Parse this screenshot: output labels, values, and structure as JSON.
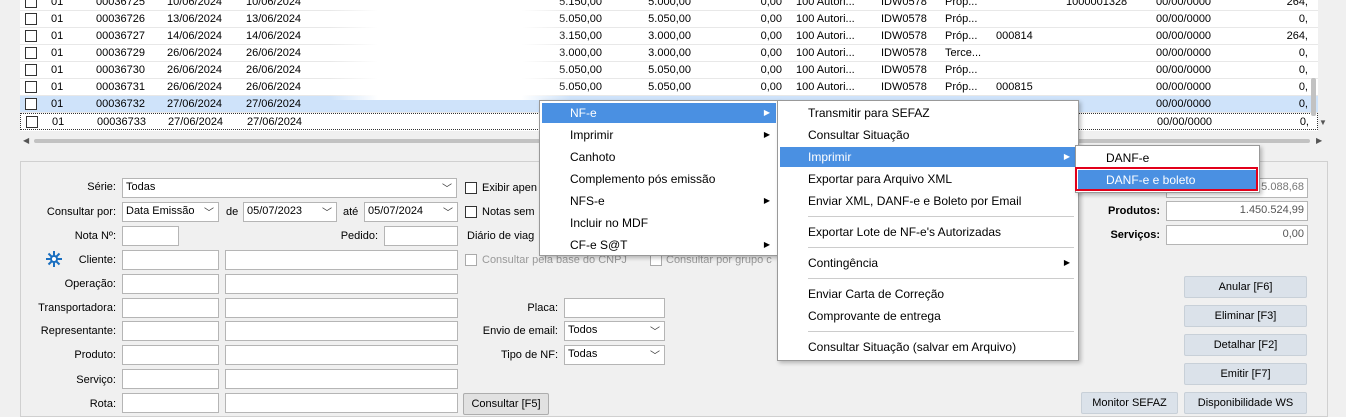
{
  "grid": {
    "rows": [
      {
        "serie": "01",
        "numero": "00036725",
        "emissao": "10/06/2024",
        "saida": "10/06/2024",
        "v1": "5.150,00",
        "v2": "5.000,00",
        "v3": "0,00",
        "status": "100 Autori...",
        "user": "IDW0578",
        "tipo": "Próp...",
        "mdf": "",
        "extra": "1000001328",
        "data": "00/00/0000",
        "last": "264,"
      },
      {
        "serie": "01",
        "numero": "00036726",
        "emissao": "13/06/2024",
        "saida": "13/06/2024",
        "v1": "5.050,00",
        "v2": "5.050,00",
        "v3": "0,00",
        "status": "100 Autori...",
        "user": "IDW0578",
        "tipo": "Próp...",
        "mdf": "",
        "extra": "",
        "data": "00/00/0000",
        "last": "0,"
      },
      {
        "serie": "01",
        "numero": "00036727",
        "emissao": "14/06/2024",
        "saida": "14/06/2024",
        "v1": "3.150,00",
        "v2": "3.000,00",
        "v3": "0,00",
        "status": "100 Autori...",
        "user": "IDW0578",
        "tipo": "Próp...",
        "mdf": "000814",
        "extra": "",
        "data": "00/00/0000",
        "last": "264,"
      },
      {
        "serie": "01",
        "numero": "00036729",
        "emissao": "26/06/2024",
        "saida": "26/06/2024",
        "v1": "3.000,00",
        "v2": "3.000,00",
        "v3": "0,00",
        "status": "100 Autori...",
        "user": "IDW0578",
        "tipo": "Terce...",
        "mdf": "",
        "extra": "",
        "data": "00/00/0000",
        "last": "0,"
      },
      {
        "serie": "01",
        "numero": "00036730",
        "emissao": "26/06/2024",
        "saida": "26/06/2024",
        "v1": "5.050,00",
        "v2": "5.050,00",
        "v3": "0,00",
        "status": "100 Autori...",
        "user": "IDW0578",
        "tipo": "Próp...",
        "mdf": "",
        "extra": "",
        "data": "00/00/0000",
        "last": "0,"
      },
      {
        "serie": "01",
        "numero": "00036731",
        "emissao": "26/06/2024",
        "saida": "26/06/2024",
        "v1": "5.050,00",
        "v2": "5.050,00",
        "v3": "0,00",
        "status": "100 Autori...",
        "user": "IDW0578",
        "tipo": "Próp...",
        "mdf": "000815",
        "extra": "",
        "data": "00/00/0000",
        "last": "0,"
      },
      {
        "serie": "01",
        "numero": "00036732",
        "emissao": "27/06/2024",
        "saida": "27/06/2024",
        "v1": "",
        "v2": "",
        "v3": "",
        "status": "",
        "user": "",
        "tipo": "",
        "mdf": "",
        "extra": "",
        "data": "00/00/0000",
        "last": "0,"
      },
      {
        "serie": "01",
        "numero": "00036733",
        "emissao": "27/06/2024",
        "saida": "27/06/2024",
        "v1": "",
        "v2": "",
        "v3": "",
        "status": "",
        "user": "",
        "tipo": "",
        "mdf": "",
        "extra": "",
        "data": "00/00/0000",
        "last": "0,"
      }
    ]
  },
  "filters": {
    "serie_label": "Série:",
    "serie_value": "Todas",
    "consultar_label": "Consultar por:",
    "consultar_value": "Data Emissão",
    "de_label": "de",
    "de_value": "05/07/2023",
    "ate_label": "até",
    "ate_value": "05/07/2024",
    "nota_label": "Nota Nº:",
    "pedido_label": "Pedido:",
    "cliente_label": "Cliente:",
    "operacao_label": "Operação:",
    "transportadora_label": "Transportadora:",
    "representante_label": "Representante:",
    "produto_label": "Produto:",
    "servico_label": "Serviço:",
    "rota_label": "Rota:",
    "exibir_label": "Exibir apen",
    "notas_label": "Notas sem",
    "diario_label": "Diário de viag",
    "base_cnpj_label": "Consultar pela base do CNPJ",
    "grupo_label": "Consultar por grupo c",
    "placa_label": "Placa:",
    "envio_label": "Envio de email:",
    "envio_value": "Todos",
    "tipo_label": "Tipo de NF:",
    "tipo_value": "Todas",
    "consultar_button": "Consultar [F5]"
  },
  "totals": {
    "total_value": "5.088,68",
    "produtos_label": "Produtos:",
    "produtos_value": "1.450.524,99",
    "servicos_label": "Serviços:",
    "servicos_value": "0,00"
  },
  "buttons": {
    "anular": "Anular [F6]",
    "eliminar": "Eliminar [F3]",
    "detalhar": "Detalhar [F2]",
    "emitir": "Emitir [F7]",
    "monitor": "Monitor SEFAZ",
    "disponibilidade": "Disponibilidade WS"
  },
  "menu1": [
    "NF-e",
    "Imprimir",
    "Canhoto",
    "Complemento pós emissão",
    "NFS-e",
    "Incluir no MDF",
    "CF-e S@T"
  ],
  "menu2": [
    "Transmitir para SEFAZ",
    "Consultar Situação",
    "Imprimir",
    "Exportar para Arquivo XML",
    "Enviar XML, DANF-e e Boleto por Email",
    "Exportar Lote de NF-e's Autorizadas",
    "Contingência",
    "Enviar Carta de Correção",
    "Comprovante de entrega",
    "Consultar Situação (salvar em Arquivo)"
  ],
  "menu3": [
    "DANF-e",
    "DANF-e e boleto"
  ],
  "colors": {
    "highlight": "#4a90e2",
    "red_box": "#e2001a",
    "selected_row": "#cfe3fa"
  }
}
